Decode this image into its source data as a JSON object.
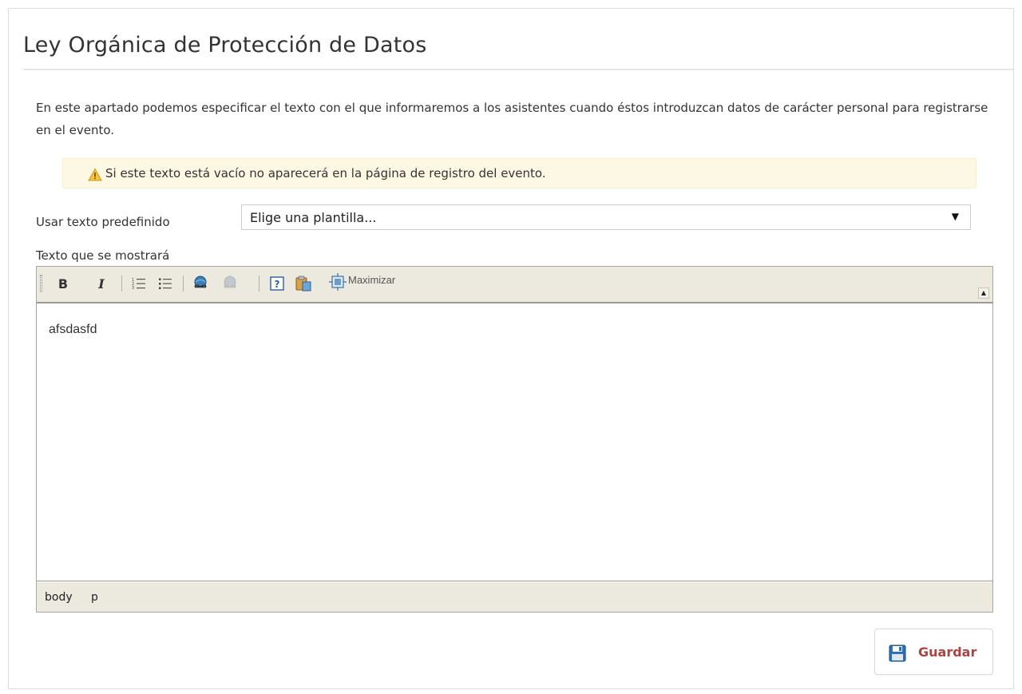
{
  "page": {
    "title": "Ley Orgánica de Protección de Datos",
    "intro_text": "En este apartado podemos especificar el texto con el que informaremos a los asistentes cuando éstos introduzcan datos de carácter personal para registrarse en el evento."
  },
  "warning": {
    "icon": "warning-icon",
    "text": "Si este texto está vacío no aparecerá en la página de registro del evento.",
    "background_color": "#fcf8e3"
  },
  "predefined": {
    "label": "Usar texto predefinido",
    "selected_value": "Elige una plantilla...",
    "arrow": "▼"
  },
  "editor": {
    "label": "Texto que se mostrará",
    "toolbar": {
      "bold_label": "B",
      "italic_label": "I",
      "maximize_label": "Maximizar",
      "collapse_glyph": "▲"
    },
    "content_text": "afsdasfd",
    "status_path": [
      "body",
      "p"
    ],
    "toolbar_color": "#eceade"
  },
  "actions": {
    "save_label": "Guardar",
    "save_color": "#a94442"
  }
}
